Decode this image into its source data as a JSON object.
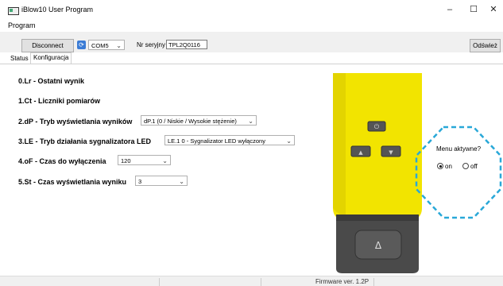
{
  "window": {
    "title": "iBlow10 User Program"
  },
  "menu": {
    "program": "Program"
  },
  "toolbar": {
    "disconnect": "Disconnect",
    "port": "COM5",
    "serial_label": "Nr seryjny",
    "serial_value": "TPL2Q0116",
    "refresh": "Odśwież"
  },
  "tabs": {
    "status": "Status",
    "config": "Konfiguracja"
  },
  "settings": {
    "s0": "0.Lr - Ostatni wynik",
    "s1": "1.Ct - Liczniki pomiarów",
    "s2": "2.dP - Tryb wyświetlania wyników",
    "s2_value": "dP.1 (0 / Niskie / Wysokie stężenie)",
    "s3": "3.LE - Tryb działania sygnalizatora LED",
    "s3_value": "LE.1 0 - Sygnalizator LED wyłączony",
    "s4": "4.oF - Czas do wyłączenia",
    "s4_value": "120",
    "s5": "5.St - Czas wyświetlania wyniku",
    "s5_value": "3"
  },
  "menu_active": {
    "label": "Menu aktywne?",
    "on": "on",
    "off": "off",
    "selected": "on"
  },
  "statusbar": {
    "firmware": "Firmware ver. 1.2P"
  },
  "colors": {
    "device_yellow": "#f2e400",
    "device_grip": "#4a4a4a",
    "highlight": "#29a8d8"
  }
}
